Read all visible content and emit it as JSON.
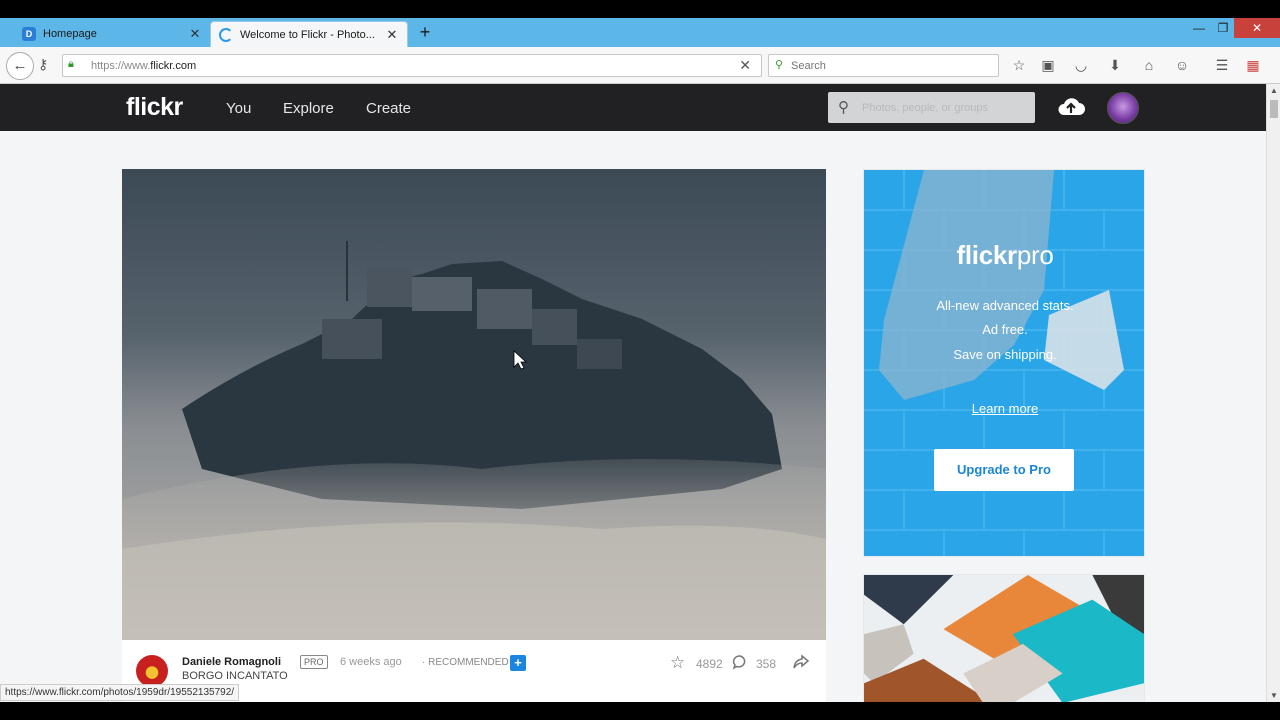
{
  "browser": {
    "tabs": [
      {
        "title": "Homepage",
        "active": false
      },
      {
        "title": "Welcome to Flickr - Photo...",
        "active": true
      }
    ],
    "url_prefix": "https://www.",
    "url_domain": "flickr.com",
    "search_placeholder": "Search",
    "status_url": "https://www.flickr.com/photos/1959dr/19552135792/"
  },
  "flickr": {
    "logo": "flickr",
    "nav": [
      "You",
      "Explore",
      "Create"
    ],
    "search_placeholder": "Photos, people, or groups"
  },
  "photo": {
    "owner": "Daniele Romagnoli",
    "badge": "PRO",
    "time": "6 weeks ago",
    "tag": "· RECOMMENDED",
    "title": "BORGO INCANTATO",
    "faves": "4892",
    "comments": "358"
  },
  "pro_ad": {
    "logo_bold": "flickr",
    "logo_light": "pro",
    "lines": [
      "All-new advanced stats.",
      "Ad free.",
      "Save on shipping."
    ],
    "learn_more": "Learn more",
    "button": "Upgrade to Pro"
  },
  "colors": {
    "tab_bar": "#5cb6e8",
    "flickr_header": "#212124",
    "pro_blue": "#2aa6e8",
    "accent_blue": "#1b86e0"
  }
}
